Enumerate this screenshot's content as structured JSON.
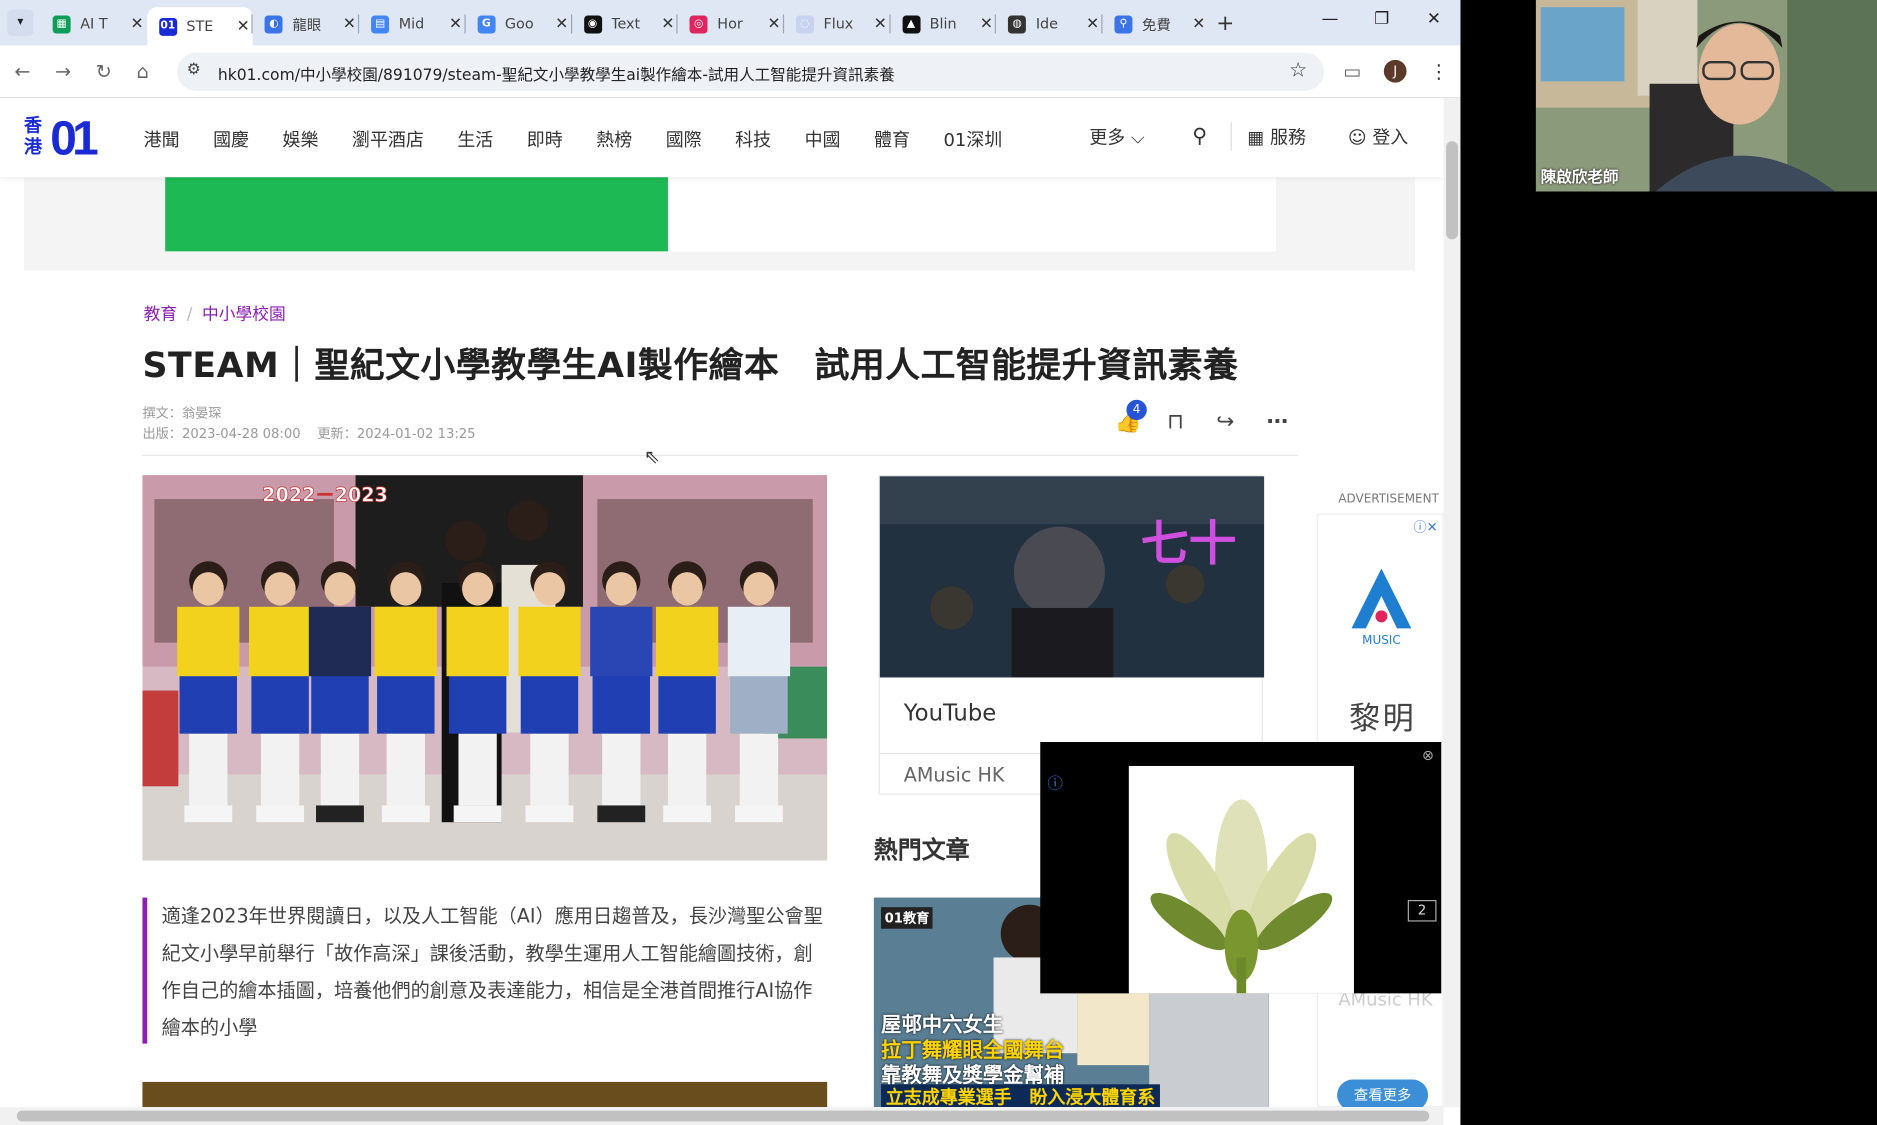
{
  "tabs": [
    {
      "label": "AI T",
      "icon": "sheets-icon",
      "color": "#0f9d58",
      "glyph": "▦"
    },
    {
      "label": "STE",
      "icon": "hk01-icon",
      "color": "#1a2bd6",
      "glyph": "01"
    },
    {
      "label": "龍眼",
      "icon": "swirl-icon",
      "color": "#3b74e8",
      "glyph": "◐"
    },
    {
      "label": "Mid",
      "icon": "docs-icon",
      "color": "#4285f4",
      "glyph": "▤"
    },
    {
      "label": "Goo",
      "icon": "translate-icon",
      "color": "#4285f4",
      "glyph": "G"
    },
    {
      "label": "Text",
      "icon": "discord-icon",
      "color": "#111111",
      "glyph": "◉"
    },
    {
      "label": "Hor",
      "icon": "pin-icon",
      "color": "#e0245e",
      "glyph": "◎"
    },
    {
      "label": "Flux",
      "icon": "flux-icon",
      "color": "#c7d3ef",
      "glyph": "◌"
    },
    {
      "label": "Blin",
      "icon": "triangle-icon",
      "color": "#111111",
      "glyph": "▲"
    },
    {
      "label": "Ide",
      "icon": "ideogram-icon",
      "color": "#333333",
      "glyph": "◍"
    },
    {
      "label": "免費",
      "icon": "search-icon",
      "color": "#3b74e8",
      "glyph": "⚲"
    }
  ],
  "browser": {
    "url": "hk01.com/中小學校園/891079/steam-聖紀文小學教學生ai製作繪本-試用人工智能提升資訊素養",
    "profile_initial": "J"
  },
  "site": {
    "logo_hk": "香港",
    "logo_01": "01",
    "nav": [
      "港聞",
      "國慶",
      "娛樂",
      "瀏平酒店",
      "生活",
      "即時",
      "熱榜",
      "國際",
      "科技",
      "中國",
      "體育",
      "01深圳"
    ],
    "more": "更多",
    "services": "服務",
    "login": "登入"
  },
  "article": {
    "breadcrumb": [
      "教育",
      "中小學校園"
    ],
    "headline": "STEAM｜聖紀文小學教學生AI製作繪本　試用人工智能提升資訊素養",
    "author": "撰文：翁晏琛",
    "published": "出版：2023-04-28 08:00",
    "updated": "更新：2024-01-02 13:25",
    "like_count": "4",
    "quote": "適逢2023年世界閱讀日，以及人工智能（AI）應用日趨普及，長沙灣聖公會聖紀文小學早前舉行「故作高深」課後活動，教學生運用人工智能繪圖技術，創作自己的繪本插圖，培養他們的創意及表達能力，相信是全港首間推行AI協作繪本的小學",
    "photo_banner": "2022－2023"
  },
  "sidebar": {
    "yt_title": "YouTube",
    "yt_sub": "AMusic HK",
    "hot_title": "熱門文章",
    "hot_tag": "01教育",
    "hot_lines": [
      "屋邨中六女生",
      "拉丁舞耀眼全國舞台",
      "靠教舞及獎學金幫補",
      "立志成專業選手　盼入浸大體育系"
    ],
    "ad_label": "ADVERTISEMENT",
    "ad_brand": "MUSIC",
    "ad_name": "黎明",
    "ad_sub": "AMusic HK",
    "more_btn": "查看更多",
    "tt_logo": "七十"
  },
  "popup": {
    "counter": "2"
  },
  "webcam": {
    "name": "陳啟欣老師"
  }
}
